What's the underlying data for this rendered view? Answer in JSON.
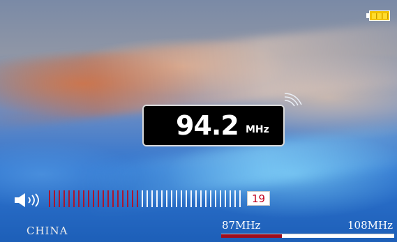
{
  "frequency": {
    "value": "94.2",
    "unit": "MHz"
  },
  "region": "CHINA",
  "band": {
    "min_label": "87MHz",
    "max_label": "108MHz",
    "position": 0.35
  },
  "volume": {
    "level": "19",
    "bars_total": 40,
    "bars_filled": 19
  },
  "battery": {
    "level_fraction": 1.0
  },
  "icons": {
    "battery": "battery-full-icon",
    "signal": "radio-signal-icon",
    "speaker": "speaker-icon"
  },
  "colors": {
    "volume_on": "#a8162f",
    "volume_off": "#f2f6ff",
    "tuner_fill": "#9e0d1e",
    "battery": "#f2c200",
    "volume_text": "#c0001b"
  }
}
